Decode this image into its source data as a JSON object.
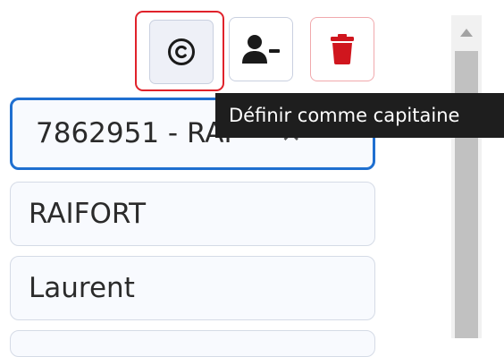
{
  "toolbar": {
    "set_captain_icon": "copyright-circle-icon",
    "remove_player_icon": "user-minus-icon",
    "delete_icon": "trash-icon",
    "accent_danger": "#e0222b",
    "accent_focus": "#1f6fd0"
  },
  "tooltip": {
    "text": "Définir comme capitaine"
  },
  "player_select": {
    "value": "7862951 - RAI"
  },
  "last_name": {
    "value": "RAIFORT"
  },
  "first_name": {
    "value": "Laurent"
  }
}
